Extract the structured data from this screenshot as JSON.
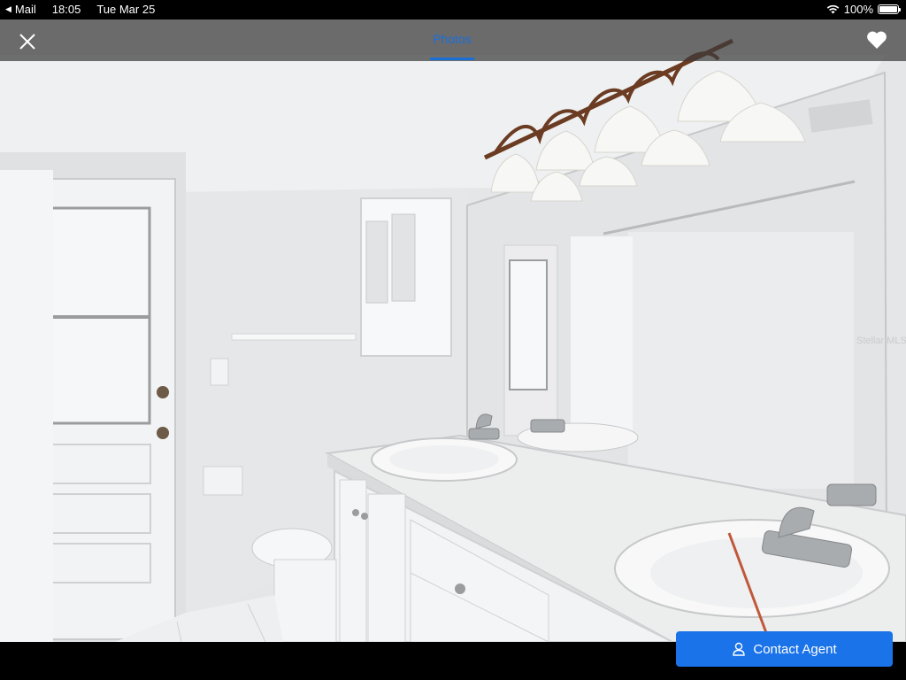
{
  "status_bar": {
    "back_app": "Mail",
    "time": "18:05",
    "date": "Tue Mar 25",
    "battery": "100%",
    "battery_level": 1.0,
    "icons": [
      "back-arrow-icon",
      "wifi-icon",
      "battery-icon"
    ]
  },
  "nav": {
    "tab_label": "Photos",
    "close_icon": "close-icon",
    "favorite_icon": "heart-icon",
    "accent_color": "#1a6fd9"
  },
  "photo": {
    "watermark": "Stellar MLS"
  },
  "actions": {
    "contact_label": "Contact Agent",
    "contact_icon": "person-icon",
    "button_color": "#1a73e8"
  }
}
